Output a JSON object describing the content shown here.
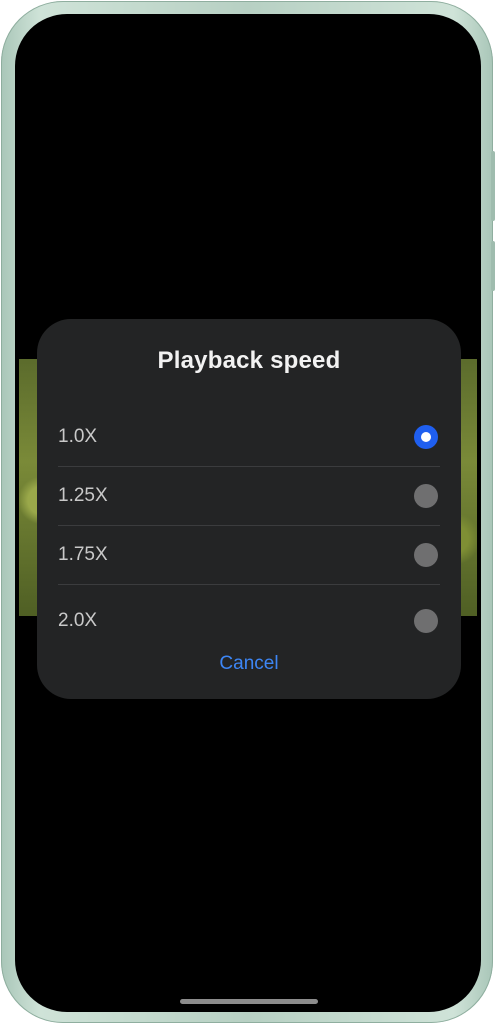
{
  "dialog": {
    "title": "Playback speed",
    "options": [
      {
        "label": "1.0X",
        "selected": true
      },
      {
        "label": "1.25X",
        "selected": false
      },
      {
        "label": "1.75X",
        "selected": false
      },
      {
        "label": "2.0X",
        "selected": false
      }
    ],
    "cancel_label": "Cancel"
  },
  "colors": {
    "accent": "#1f5ff0",
    "link": "#3d86f5",
    "dialog_background": "#232425"
  }
}
